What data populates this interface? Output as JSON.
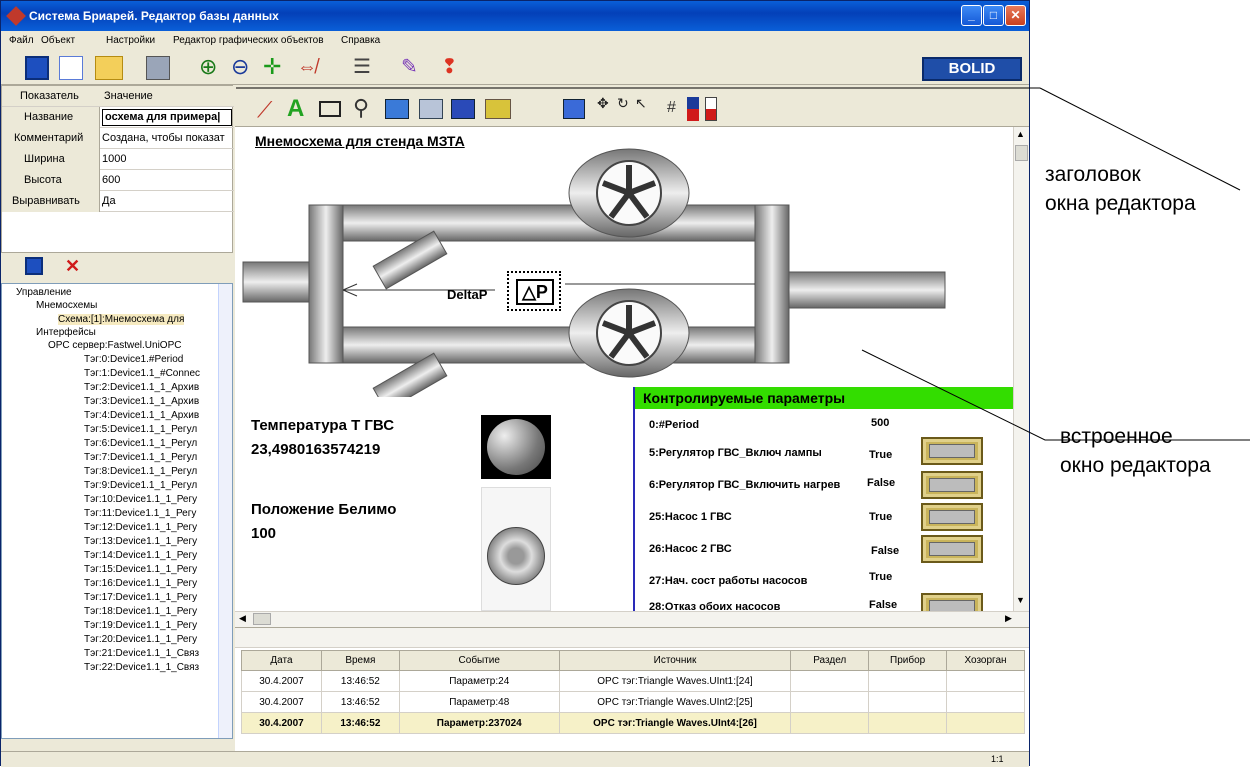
{
  "window": {
    "title": "Система Бриарей. Редактор базы данных",
    "logo": "BOLID"
  },
  "menu": [
    "Файл",
    "Объект",
    "Настройки",
    "Редактор графических объектов",
    "Справка"
  ],
  "props": {
    "header_key": "Показатель",
    "header_val": "Значение",
    "rows": [
      {
        "key": "Название",
        "value": "осхема для примера|"
      },
      {
        "key": "Комментарий",
        "value": "Создана, чтобы показат"
      },
      {
        "key": "Ширина",
        "value": "1000"
      },
      {
        "key": "Высота",
        "value": "600"
      },
      {
        "key": "Выравнивать",
        "value": "Да"
      }
    ]
  },
  "tree": {
    "root": "Управление",
    "mnemo": "Мнемосхемы",
    "scheme": "Схема:[1]:Мнемосхема для",
    "ifaces": "Интерфейсы",
    "opc": "ОРС сервер:Fastwel.UniOPC",
    "tags": [
      "Тэг:0:Device1.#Period",
      "Тэг:1:Device1.1_#Connec",
      "Тэг:2:Device1.1_1_Архив",
      "Тэг:3:Device1.1_1_Архив",
      "Тэг:4:Device1.1_1_Архив",
      "Тэг:5:Device1.1_1_Регул",
      "Тэг:6:Device1.1_1_Регул",
      "Тэг:7:Device1.1_1_Регул",
      "Тэг:8:Device1.1_1_Регул",
      "Тэг:9:Device1.1_1_Регул",
      "Тэг:10:Device1.1_1_Регу",
      "Тэг:11:Device1.1_1_Регу",
      "Тэг:12:Device1.1_1_Регу",
      "Тэг:13:Device1.1_1_Регу",
      "Тэг:14:Device1.1_1_Регу",
      "Тэг:15:Device1.1_1_Регу",
      "Тэг:16:Device1.1_1_Регу",
      "Тэг:17:Device1.1_1_Регу",
      "Тэг:18:Device1.1_1_Регу",
      "Тэг:19:Device1.1_1_Регу",
      "Тэг:20:Device1.1_1_Регу",
      "Тэг:21:Device1.1_1_Связ",
      "Тэг:22:Device1.1_1_Связ"
    ]
  },
  "canvas": {
    "title": "Мнемосхема для стенда МЗТА",
    "deltap_label": "DeltaP",
    "deltap_symbol": "△P",
    "temp_label": "Температура Т ГВС",
    "temp_value": "23,4980163574219",
    "belimo_label": "Положение Белимо",
    "belimo_value": "100",
    "params_title": "Контролируемые параметры",
    "params": [
      {
        "name": "0:#Period",
        "value": "500"
      },
      {
        "name": "5:Регулятор ГВС_Включ лампы",
        "value": "True"
      },
      {
        "name": "6:Регулятор ГВС_Включить нагрев",
        "value": "False"
      },
      {
        "name": "25:Насос 1 ГВС",
        "value": "True"
      },
      {
        "name": "26:Насос 2 ГВС",
        "value": "False"
      },
      {
        "name": "27:Нач. сост работы насосов",
        "value": "True"
      },
      {
        "name": "28:Отказ обоих насосов",
        "value": "False"
      }
    ]
  },
  "events": {
    "headers": [
      "Дата",
      "Время",
      "Событие",
      "Источник",
      "Раздел",
      "Прибор",
      "Хозорган"
    ],
    "rows": [
      [
        "30.4.2007",
        "13:46:52",
        "Параметр:24",
        "OPC тэг:Triangle Waves.UInt1:[24]",
        "",
        "",
        ""
      ],
      [
        "30.4.2007",
        "13:46:52",
        "Параметр:48",
        "OPC тэг:Triangle Waves.UInt2:[25]",
        "",
        "",
        ""
      ],
      [
        "30.4.2007",
        "13:46:52",
        "Параметр:237024",
        "OPC тэг:Triangle Waves.UInt4:[26]",
        "",
        "",
        ""
      ]
    ]
  },
  "status": {
    "zoom": "1:1"
  },
  "annotations": {
    "title_a": "заголовок",
    "title_b": "окна редактора",
    "embed_a": "встроенное",
    "embed_b": "окно редактора"
  },
  "colors": {
    "title_bar": "#0a5fd8",
    "params_header": "#33dd00",
    "logo_bg": "#1f4ea8"
  }
}
